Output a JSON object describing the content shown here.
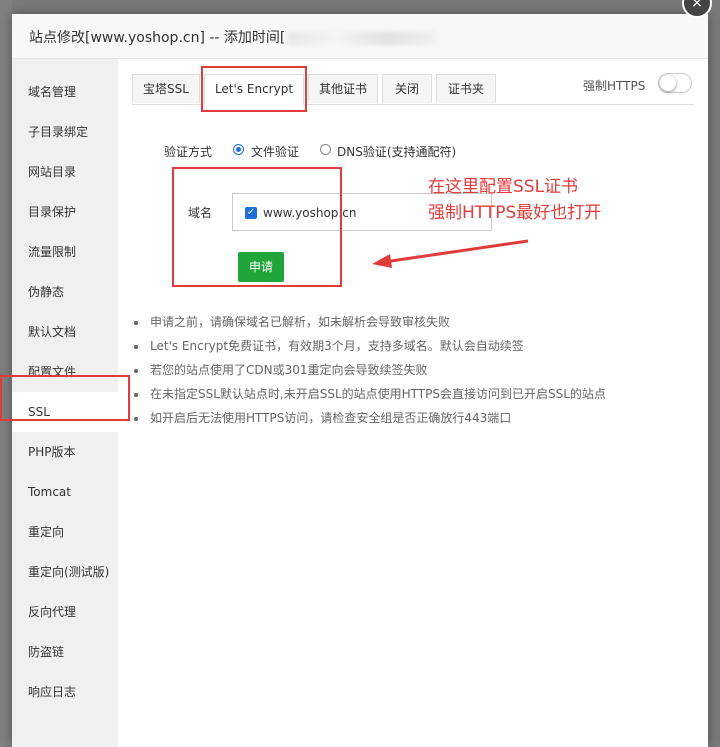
{
  "dialog": {
    "title": "站点修改[www.yoshop.cn] -- 添加时间[",
    "close_symbol": "×"
  },
  "sidebar": {
    "items": [
      {
        "label": "域名管理"
      },
      {
        "label": "子目录绑定"
      },
      {
        "label": "网站目录"
      },
      {
        "label": "目录保护"
      },
      {
        "label": "流量限制"
      },
      {
        "label": "伪静态"
      },
      {
        "label": "默认文档"
      },
      {
        "label": "配置文件"
      },
      {
        "label": "SSL"
      },
      {
        "label": "PHP版本"
      },
      {
        "label": "Tomcat"
      },
      {
        "label": "重定向"
      },
      {
        "label": "重定向(测试版)"
      },
      {
        "label": "反向代理"
      },
      {
        "label": "防盗链"
      },
      {
        "label": "响应日志"
      }
    ],
    "active_index": 8
  },
  "tabs": {
    "items": [
      {
        "label": "宝塔SSL"
      },
      {
        "label": "Let's Encrypt"
      },
      {
        "label": "其他证书"
      },
      {
        "label": "关闭"
      },
      {
        "label": "证书夹"
      }
    ],
    "active_index": 1,
    "https_label": "强制HTTPS",
    "https_enabled": false
  },
  "form": {
    "verify_label": "验证方式",
    "option_file": "文件验证",
    "option_dns": "DNS验证(支持通配符)",
    "selected": "文件验证",
    "domain_label": "域名",
    "domain_value": "www.yoshop.cn",
    "domain_checked": true,
    "check_symbol": "✓",
    "apply_label": "申请"
  },
  "notes": [
    "申请之前，请确保域名已解析，如未解析会导致审核失败",
    "Let's Encrypt免费证书，有效期3个月，支持多域名。默认会自动续签",
    "若您的站点使用了CDN或301重定向会导致续签失败",
    "在未指定SSL默认站点时,未开启SSL的站点使用HTTPS会直接访问到已开启SSL的站点",
    "如开启后无法使用HTTPS访问，请检查安全组是否正确放行443端口"
  ],
  "annotation": {
    "line1": "在这里配置SSL证书",
    "line2": "强制HTTPS最好也打开",
    "color": "#e03c3c"
  },
  "colors": {
    "primary_blue": "#1e6fd8",
    "apply_green": "#20a53a"
  }
}
